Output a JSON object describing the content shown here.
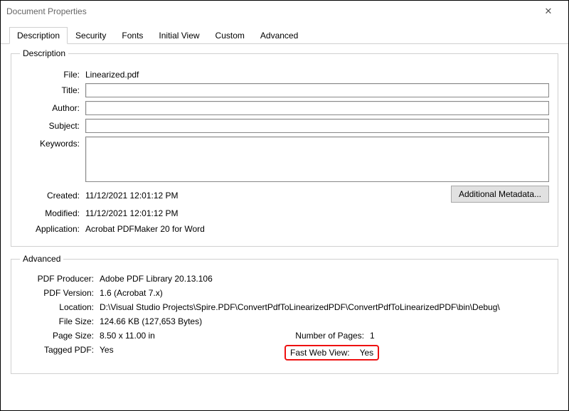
{
  "window": {
    "title": "Document Properties"
  },
  "tabs": [
    "Description",
    "Security",
    "Fonts",
    "Initial View",
    "Custom",
    "Advanced"
  ],
  "activeTab": 0,
  "descGroup": {
    "legend": "Description",
    "labels": {
      "file": "File:",
      "title": "Title:",
      "author": "Author:",
      "subject": "Subject:",
      "keywords": "Keywords:",
      "created": "Created:",
      "modified": "Modified:",
      "application": "Application:"
    },
    "file": "Linearized.pdf",
    "title": "",
    "author": "",
    "subject": "",
    "keywords": "",
    "created": "11/12/2021 12:01:12 PM",
    "modified": "11/12/2021 12:01:12 PM",
    "application": "Acrobat PDFMaker 20 for Word",
    "additionalMetadataBtn": "Additional Metadata..."
  },
  "advGroup": {
    "legend": "Advanced",
    "labels": {
      "pdfProducer": "PDF Producer:",
      "pdfVersion": "PDF Version:",
      "location": "Location:",
      "fileSize": "File Size:",
      "pageSize": "Page Size:",
      "taggedPdf": "Tagged PDF:",
      "numPages": "Number of Pages:",
      "fastWebView": "Fast Web View:"
    },
    "pdfProducer": "Adobe PDF Library 20.13.106",
    "pdfVersion": "1.6 (Acrobat 7.x)",
    "location": "D:\\Visual Studio Projects\\Spire.PDF\\ConvertPdfToLinearizedPDF\\ConvertPdfToLinearizedPDF\\bin\\Debug\\",
    "fileSize": "124.66 KB (127,653 Bytes)",
    "pageSize": "8.50 x 11.00 in",
    "taggedPdf": "Yes",
    "numPages": "1",
    "fastWebView": "Yes"
  }
}
